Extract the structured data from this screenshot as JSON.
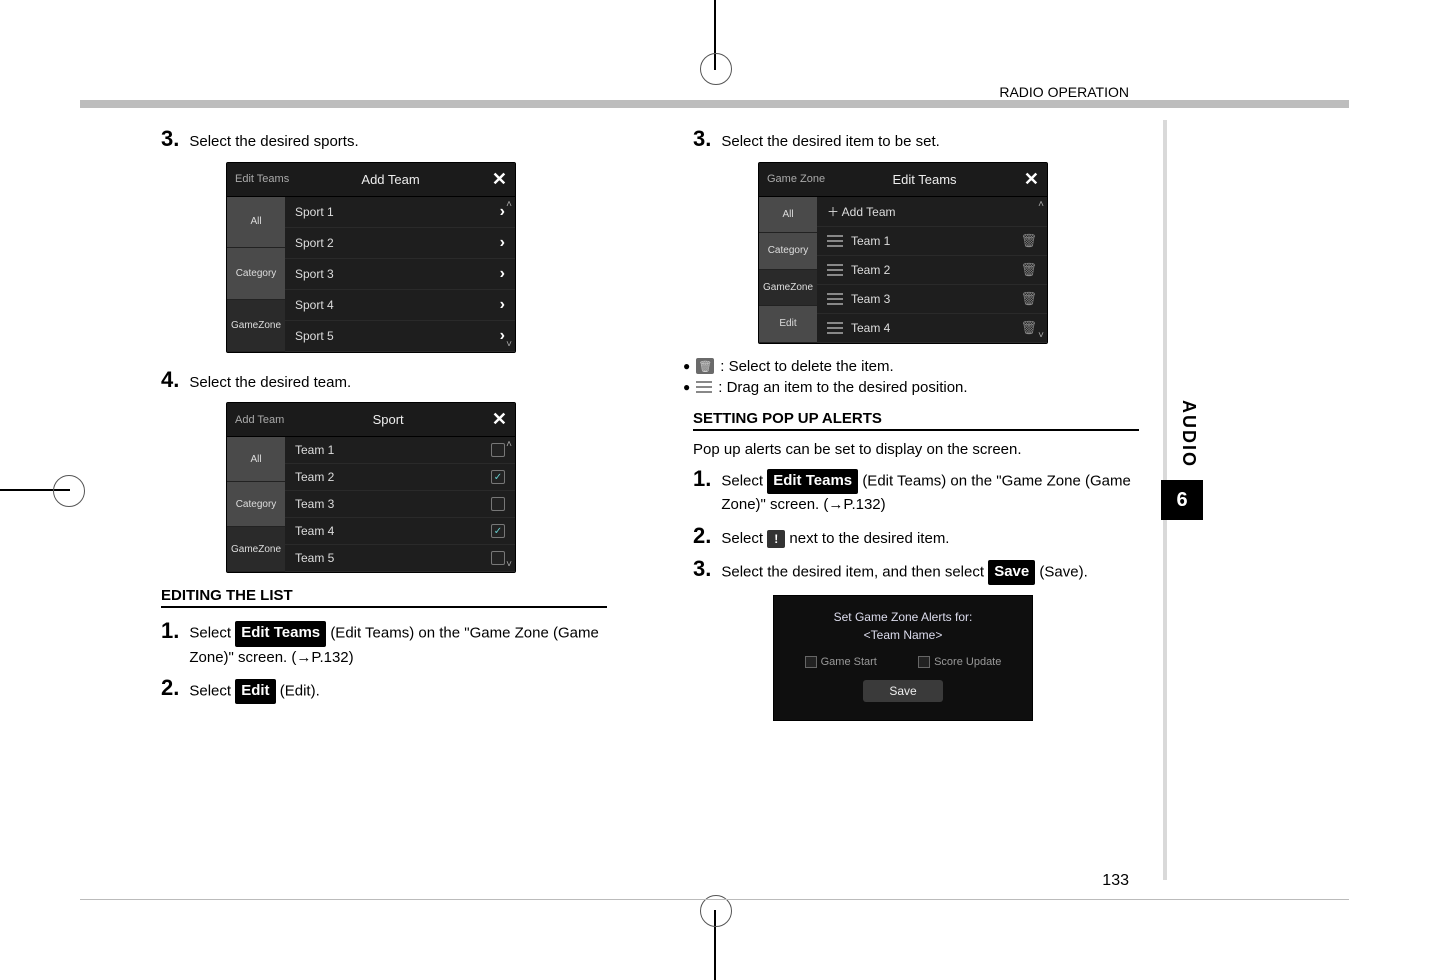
{
  "section_header": "RADIO OPERATION",
  "side_tab": "AUDIO",
  "chapter": "6",
  "page_number": "133",
  "left": {
    "step3": {
      "num": "3.",
      "text": "Select the desired sports."
    },
    "shot_add_team": {
      "back": "Edit Teams",
      "title": "Add Team",
      "close": "✕",
      "side": [
        "All",
        "Category",
        "GameZone"
      ],
      "rows": [
        "Sport 1",
        "Sport 2",
        "Sport 3",
        "Sport 4",
        "Sport 5"
      ]
    },
    "step4": {
      "num": "4.",
      "text": "Select the desired team."
    },
    "shot_sport": {
      "back": "Add Team",
      "title": "Sport",
      "close": "✕",
      "side": [
        "All",
        "Category",
        "GameZone"
      ],
      "rows": [
        {
          "label": "Team 1",
          "checked": false
        },
        {
          "label": "Team 2",
          "checked": true
        },
        {
          "label": "Team 3",
          "checked": false
        },
        {
          "label": "Team 4",
          "checked": true
        },
        {
          "label": "Team 5",
          "checked": false
        }
      ]
    },
    "editing_subhead": "EDITING THE LIST",
    "step1": {
      "num": "1.",
      "pre": "Select ",
      "button": "Edit Teams",
      "post": " (Edit Teams) on the \"Game Zone (Game Zone)\" screen. (→P.132)"
    },
    "step2": {
      "num": "2.",
      "pre": "Select ",
      "button": "Edit",
      "post": " (Edit)."
    }
  },
  "right": {
    "step3": {
      "num": "3.",
      "text": "Select the desired item to be set."
    },
    "shot_edit_teams": {
      "back": "Game Zone",
      "title": "Edit Teams",
      "close": "✕",
      "side": [
        "All",
        "Category",
        "GameZone",
        "Edit"
      ],
      "add_row": "＋ Add Team",
      "rows": [
        "Team 1",
        "Team 2",
        "Team 3",
        "Team 4"
      ]
    },
    "bullet_delete": ": Select to delete the item.",
    "bullet_drag": ": Drag an item to the desired position.",
    "alerts_subhead": "SETTING POP UP ALERTS",
    "alerts_intro": "Pop up alerts can be set to display on the screen.",
    "step1": {
      "num": "1.",
      "pre": "Select ",
      "button": "Edit Teams",
      "post": " (Edit Teams) on the \"Game Zone (Game Zone)\" screen. (→P.132)"
    },
    "step2": {
      "num": "2.",
      "pre": "Select ",
      "icon": "!",
      "post": " next to the desired item."
    },
    "step3b": {
      "num": "3.",
      "pre": "Select the desired item, and then select ",
      "button": "Save",
      "post": " (Save)."
    },
    "shot_alerts": {
      "line1": "Set Game Zone Alerts for:",
      "line2": "<Team Name>",
      "opt1": "Game Start",
      "opt2": "Score Update",
      "save": "Save"
    }
  }
}
